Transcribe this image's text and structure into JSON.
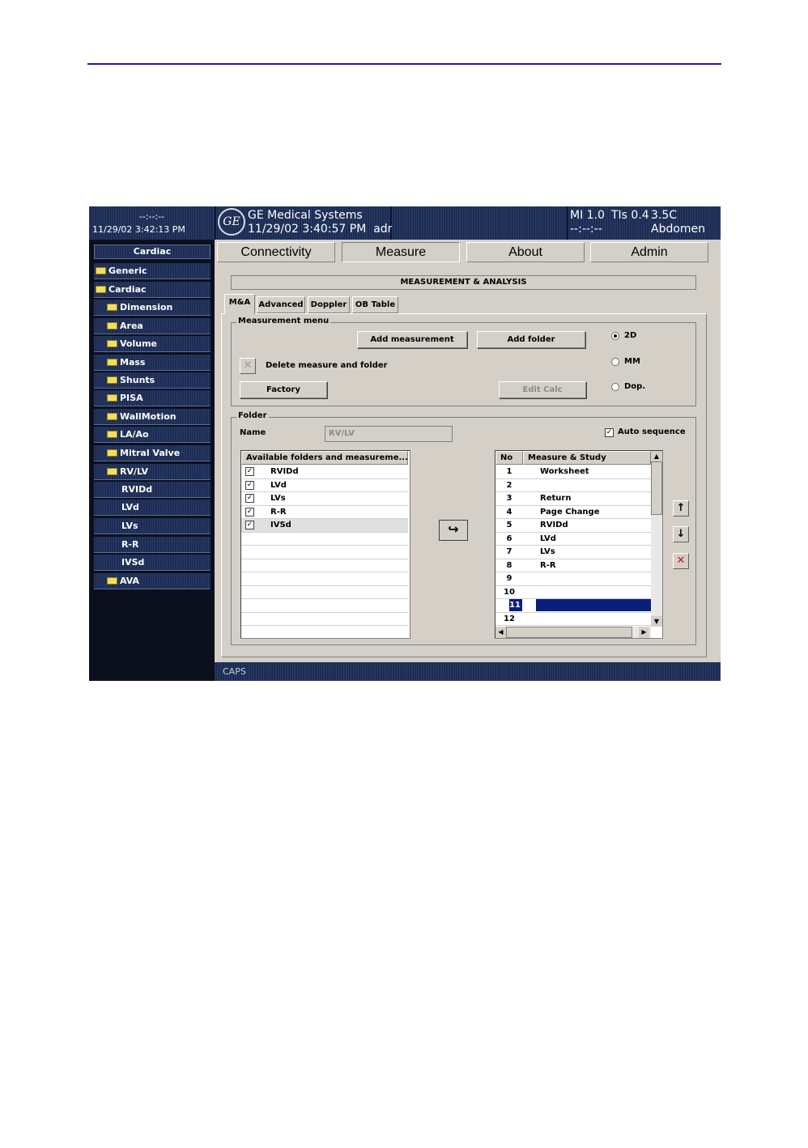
{
  "header": {
    "left_top": "--:--:--",
    "left_datetime": "11/29/02 3:42:13 PM",
    "logo_text": "GE",
    "company": "GE Medical Systems",
    "datetime": "11/29/02 3:40:57 PM",
    "user": "adm",
    "mi": "MI 1.0",
    "tis": "TIs 0.4",
    "tis_sub": "--:--:--",
    "probe": "3.5C",
    "preset": "Abdomen"
  },
  "sidebar": {
    "title": "Cardiac",
    "items": [
      {
        "label": "Generic",
        "folder": true,
        "indent": 0
      },
      {
        "label": "Cardiac",
        "folder": true,
        "indent": 0
      },
      {
        "label": "Dimension",
        "folder": true,
        "indent": 1
      },
      {
        "label": "Area",
        "folder": true,
        "indent": 1
      },
      {
        "label": "Volume",
        "folder": true,
        "indent": 1
      },
      {
        "label": "Mass",
        "folder": true,
        "indent": 1
      },
      {
        "label": "Shunts",
        "folder": true,
        "indent": 1
      },
      {
        "label": "PISA",
        "folder": true,
        "indent": 1
      },
      {
        "label": "WallMotion",
        "folder": true,
        "indent": 1
      },
      {
        "label": "LA/Ao",
        "folder": true,
        "indent": 1
      },
      {
        "label": "Mitral Valve",
        "folder": true,
        "indent": 1
      },
      {
        "label": "RV/LV",
        "folder": true,
        "indent": 1
      },
      {
        "label": "RVIDd",
        "folder": false,
        "indent": 2
      },
      {
        "label": "LVd",
        "folder": false,
        "indent": 2
      },
      {
        "label": "LVs",
        "folder": false,
        "indent": 2
      },
      {
        "label": "R-R",
        "folder": false,
        "indent": 2
      },
      {
        "label": "IVSd",
        "folder": false,
        "indent": 2
      },
      {
        "label": "AVA",
        "folder": true,
        "indent": 1
      }
    ]
  },
  "tabs": {
    "connectivity": "Connectivity",
    "measure": "Measure",
    "about": "About",
    "admin": "Admin"
  },
  "panel_title": "MEASUREMENT & ANALYSIS",
  "subtabs": {
    "ma": "M&A",
    "advanced": "Advanced",
    "doppler": "Doppler",
    "ob_table": "OB Table"
  },
  "measurement_menu": {
    "label": "Measurement menu",
    "add_measurement": "Add measurement",
    "add_folder": "Add folder",
    "delete_label": "Delete measure and folder",
    "factory": "Factory",
    "edit_calc": "Edit Calc",
    "mode_2d": "2D",
    "mode_mm": "MM",
    "mode_dop": "Dop.",
    "selected_mode": "2D"
  },
  "folder": {
    "label": "Folder",
    "name_label": "Name",
    "name_value": "RV/LV",
    "auto_sequence": "Auto sequence",
    "auto_sequence_checked": true
  },
  "available": {
    "header": "Available folders and measureme...",
    "rows": [
      {
        "label": "RVIDd",
        "checked": true
      },
      {
        "label": "LVd",
        "checked": true
      },
      {
        "label": "LVs",
        "checked": true
      },
      {
        "label": "R-R",
        "checked": true
      },
      {
        "label": "IVSd",
        "checked": true
      }
    ]
  },
  "sequence": {
    "header_no": "No",
    "header_measure": "Measure & Study",
    "rows": [
      {
        "no": "1",
        "label": "Worksheet"
      },
      {
        "no": "2",
        "label": ""
      },
      {
        "no": "3",
        "label": "Return"
      },
      {
        "no": "4",
        "label": "Page Change"
      },
      {
        "no": "5",
        "label": "RVIDd"
      },
      {
        "no": "6",
        "label": "LVd"
      },
      {
        "no": "7",
        "label": "LVs"
      },
      {
        "no": "8",
        "label": "R-R"
      },
      {
        "no": "9",
        "label": ""
      },
      {
        "no": "10",
        "label": ""
      },
      {
        "no": "11",
        "label": ""
      },
      {
        "no": "12",
        "label": ""
      }
    ],
    "selected_no": "11"
  },
  "status": {
    "caps": "CAPS"
  }
}
